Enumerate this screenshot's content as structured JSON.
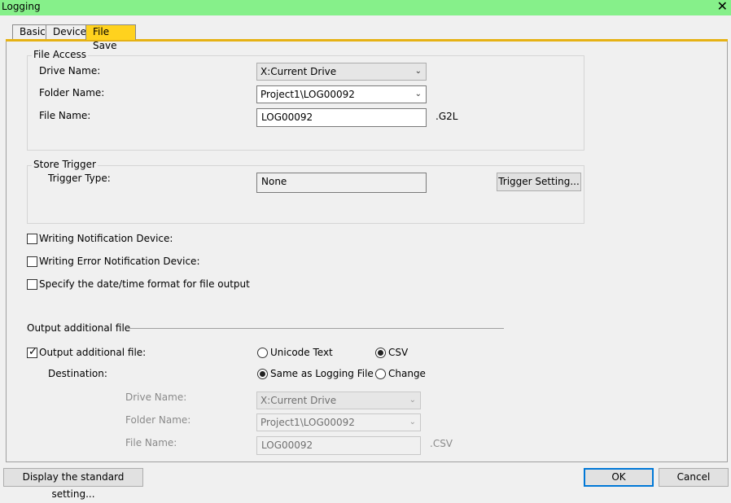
{
  "window": {
    "title": "Logging"
  },
  "tabs": [
    {
      "label": "Basic",
      "active": false
    },
    {
      "label": "Device",
      "active": false
    },
    {
      "label": "File Save",
      "active": true
    }
  ],
  "file_access": {
    "title": "File Access",
    "drive_label": "Drive Name:",
    "drive_value": "X:Current Drive",
    "folder_label": "Folder Name:",
    "folder_value": "Project1\\LOG00092",
    "file_label": "File Name:",
    "file_value": "LOG00092",
    "file_ext": ".G2L"
  },
  "store_trigger": {
    "title": "Store Trigger",
    "type_label": "Trigger Type:",
    "type_value": "None",
    "button_label": "Trigger Setting..."
  },
  "options": {
    "writing_notification": {
      "label": "Writing Notification Device:",
      "checked": false
    },
    "writing_error": {
      "label": "Writing Error Notification Device:",
      "checked": false
    },
    "date_format": {
      "label": "Specify the date/time format for file output",
      "checked": false
    }
  },
  "additional": {
    "section_title": "Output additional file",
    "checkbox_label": "Output additional file:",
    "checked": true,
    "format_unicode": "Unicode Text",
    "format_csv": "CSV",
    "selected_format": "CSV",
    "destination_label": "Destination:",
    "dest_same": "Same as Logging File",
    "dest_change": "Change",
    "selected_dest": "Same as Logging File",
    "drive_label": "Drive Name:",
    "drive_value": "X:Current Drive",
    "folder_label": "Folder Name:",
    "folder_value": "Project1\\LOG00092",
    "file_label": "File Name:",
    "file_value": "LOG00092",
    "file_ext": ".CSV"
  },
  "footer": {
    "standard_button": "Display the standard setting...",
    "ok_button": "OK",
    "cancel_button": "Cancel"
  },
  "colors": {
    "titlebar": "#86f08a",
    "active_tab": "#ffd21e",
    "default_button_border": "#0078d7"
  },
  "icons": {
    "close": "close-icon",
    "dropdown": "chevron-down-icon",
    "check": "checkmark-icon"
  }
}
